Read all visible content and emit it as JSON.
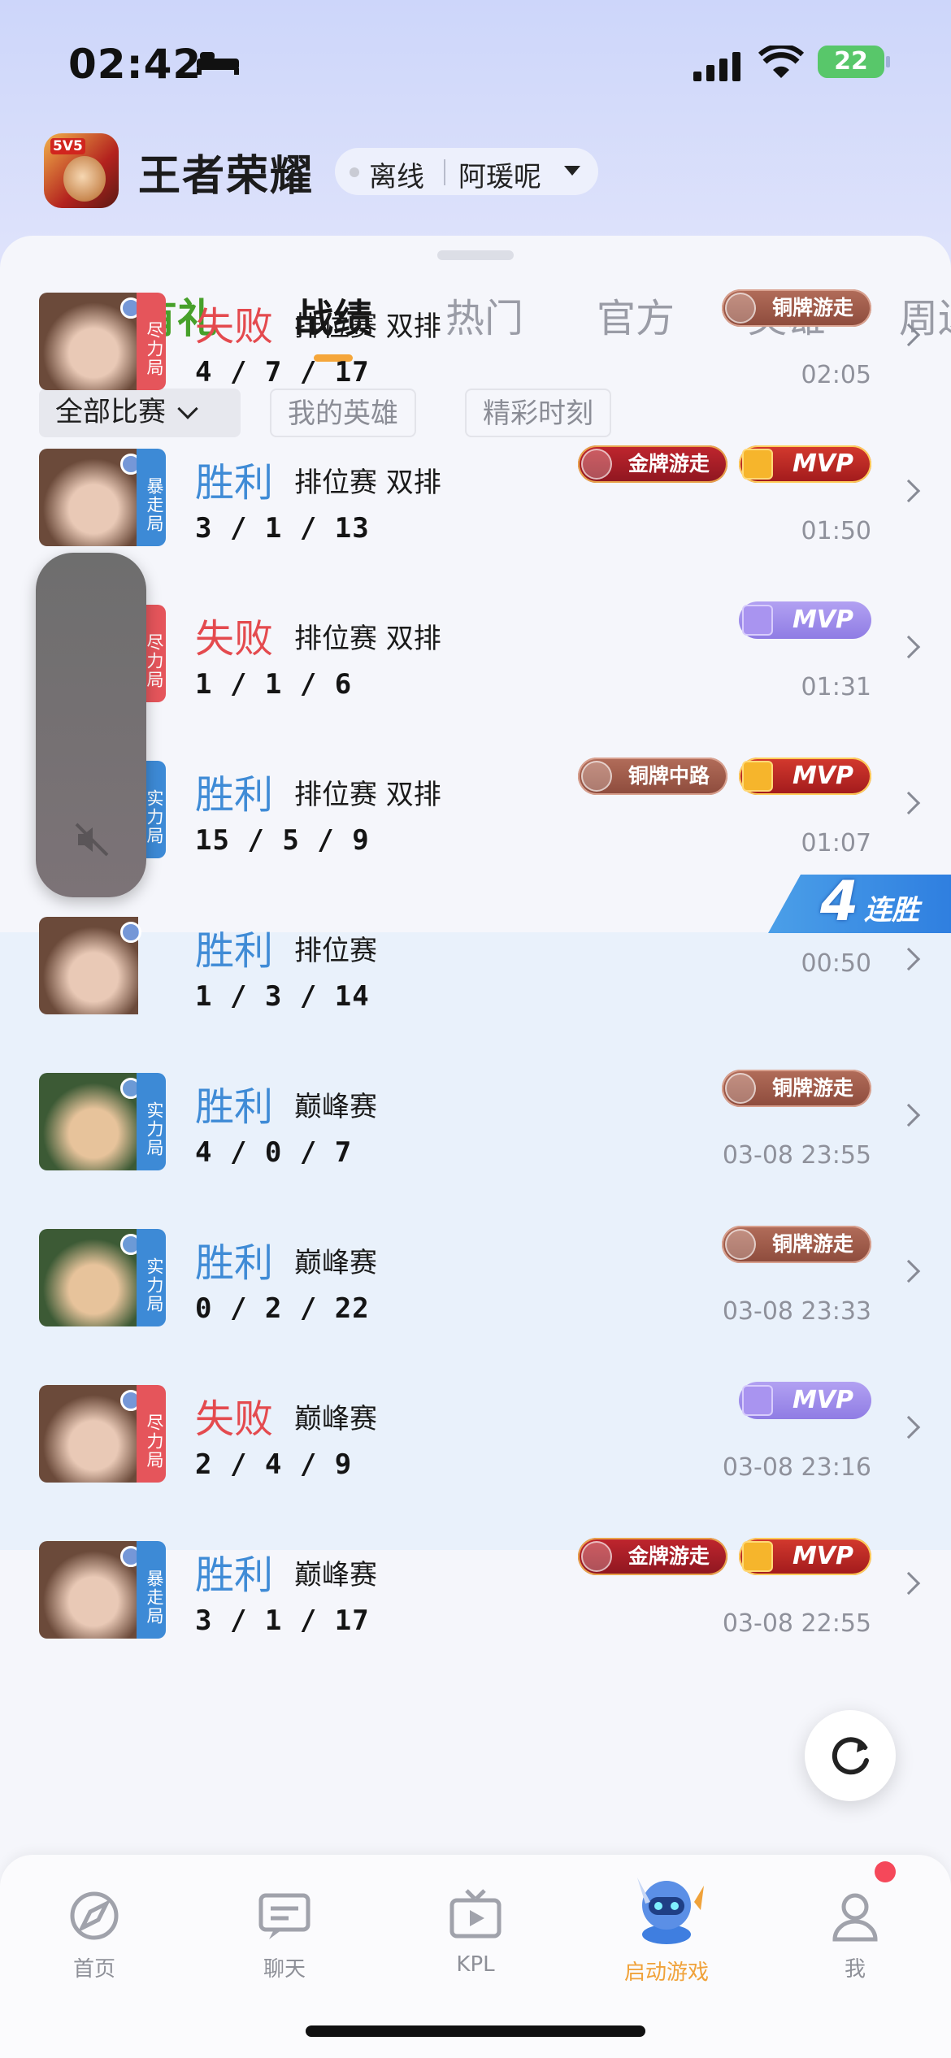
{
  "status_bar": {
    "time": "02:42",
    "battery": "22"
  },
  "header": {
    "app_icon_tag": "5V5",
    "title": "王者荣耀",
    "status": "离线",
    "nickname": "阿瑗呢"
  },
  "tabs": [
    {
      "label": "春日有礼"
    },
    {
      "label": "战绩"
    },
    {
      "label": "热门"
    },
    {
      "label": "官方"
    },
    {
      "label": "英雄"
    },
    {
      "label": "周边"
    }
  ],
  "active_tab": "战绩",
  "filters": [
    {
      "label": "全部比赛",
      "selected": true
    },
    {
      "label": "我的英雄",
      "selected": false
    },
    {
      "label": "精彩时刻",
      "selected": false
    }
  ],
  "matches": [
    {
      "result": "失败",
      "outcome": "lose",
      "mode": "排位赛 双排",
      "kda": "4 / 7 / 17",
      "time": "02:05",
      "tier": "尽力局",
      "tier_color": "red",
      "hero_colors": [
        "#6b4a3a",
        "#e9c9b6"
      ],
      "badges": [
        {
          "type": "copper",
          "label": "铜牌游走",
          "icon": "roam-emblem-icon"
        }
      ]
    },
    {
      "result": "胜利",
      "outcome": "win",
      "mode": "排位赛 双排",
      "kda": "3 / 1 / 13",
      "time": "01:50",
      "tier": "暴走局",
      "tier_color": "blue",
      "hero_colors": [
        "#6b4a3a",
        "#e9c9b6"
      ],
      "badges": [
        {
          "type": "gold",
          "label": "金牌游走",
          "icon": "roam-emblem-icon"
        },
        {
          "type": "mvp-gold",
          "label": "MVP",
          "icon": "trophy-icon"
        }
      ]
    },
    {
      "result": "失败",
      "outcome": "lose",
      "mode": "排位赛 双排",
      "kda": "1 / 1 / 6",
      "time": "01:31",
      "tier": "尽力局",
      "tier_color": "red",
      "hero_colors": [
        "#6b4a3a",
        "#e9c9b6"
      ],
      "badges": [
        {
          "type": "mvp-purple",
          "label": "MVP",
          "icon": "trophy-icon"
        }
      ]
    },
    {
      "result": "胜利",
      "outcome": "win",
      "mode": "排位赛 双排",
      "kda": "15 / 5 / 9",
      "time": "01:07",
      "tier": "实力局",
      "tier_color": "blue",
      "hero_colors": [
        "#2a3a56",
        "#d8c6bf"
      ],
      "badges": [
        {
          "type": "copper",
          "label": "铜牌中路",
          "icon": "mid-lane-icon"
        },
        {
          "type": "mvp-gold",
          "label": "MVP",
          "icon": "trophy-icon"
        }
      ]
    },
    {
      "result": "胜利",
      "outcome": "win",
      "mode": "排位赛",
      "kda": "1 / 3 / 14",
      "time": "00:50",
      "tier": "",
      "tier_color": "none",
      "hero_colors": [
        "#6b4a3a",
        "#e9c9b6"
      ],
      "badges": []
    },
    {
      "result": "胜利",
      "outcome": "win",
      "mode": "巅峰赛",
      "kda": "4 / 0 / 7",
      "time": "03-08 23:55",
      "tier": "实力局",
      "tier_color": "blue",
      "hero_colors": [
        "#3c5a35",
        "#e7c39b"
      ],
      "badges": [
        {
          "type": "copper",
          "label": "铜牌游走",
          "icon": "roam-emblem-icon"
        }
      ]
    },
    {
      "result": "胜利",
      "outcome": "win",
      "mode": "巅峰赛",
      "kda": "0 / 2 / 22",
      "time": "03-08 23:33",
      "tier": "实力局",
      "tier_color": "blue",
      "hero_colors": [
        "#3c5a35",
        "#e7c39b"
      ],
      "badges": [
        {
          "type": "copper",
          "label": "铜牌游走",
          "icon": "roam-emblem-icon"
        }
      ]
    },
    {
      "result": "失败",
      "outcome": "lose",
      "mode": "巅峰赛",
      "kda": "2 / 4 / 9",
      "time": "03-08 23:16",
      "tier": "尽力局",
      "tier_color": "red",
      "hero_colors": [
        "#6b4a3a",
        "#e9c9b6"
      ],
      "badges": [
        {
          "type": "mvp-purple",
          "label": "MVP",
          "icon": "trophy-icon"
        }
      ]
    },
    {
      "result": "胜利",
      "outcome": "win",
      "mode": "巅峰赛",
      "kda": "3 / 1 / 17",
      "time": "03-08 22:55",
      "tier": "暴走局",
      "tier_color": "blue",
      "hero_colors": [
        "#6b4a3a",
        "#e9c9b6"
      ],
      "badges": [
        {
          "type": "gold",
          "label": "金牌游走",
          "icon": "roam-emblem-icon"
        },
        {
          "type": "mvp-gold",
          "label": "MVP",
          "icon": "trophy-icon"
        }
      ]
    }
  ],
  "streak": {
    "count": "4",
    "label": "连胜"
  },
  "tabbar": [
    {
      "label": "首页",
      "icon": "home-compass-icon"
    },
    {
      "label": "聊天",
      "icon": "chat-icon"
    },
    {
      "label": "KPL",
      "icon": "tv-play-icon"
    },
    {
      "label": "启动游戏",
      "icon": "launch-game-mascot-icon"
    },
    {
      "label": "我",
      "icon": "profile-icon"
    }
  ],
  "colors": {
    "win": "#3f8bd6",
    "lose": "#e44a4e",
    "spring": "#47a02a",
    "accent": "#f5a63a",
    "streak_bg": "#e9f1fb"
  }
}
